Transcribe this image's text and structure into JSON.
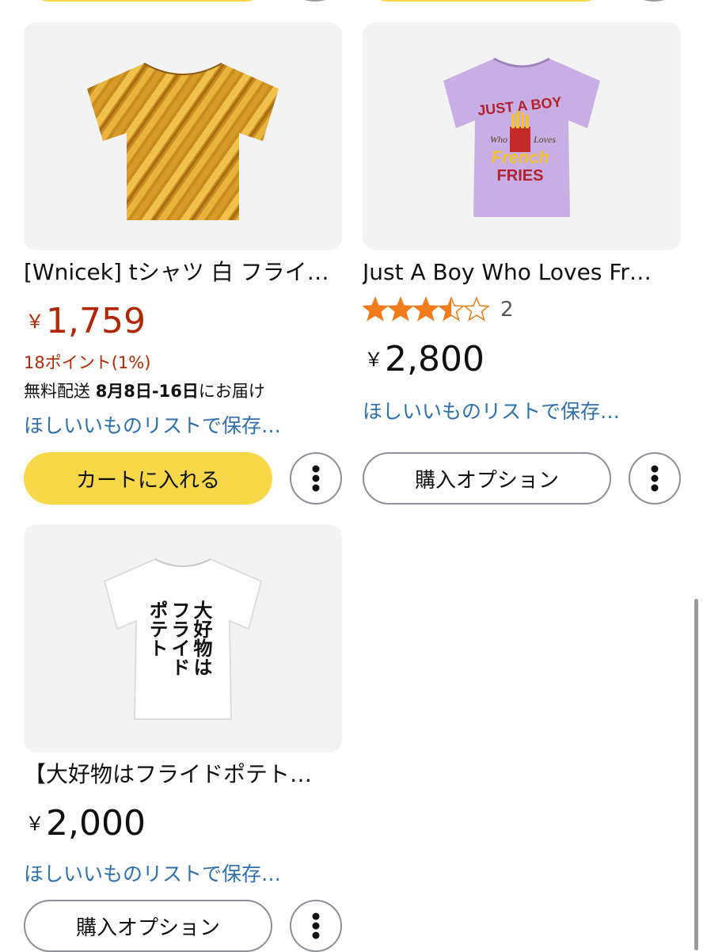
{
  "products": [
    {
      "title": "[Wnicek] tシャツ 白 フライ…",
      "price_symbol": "￥",
      "price": "1,759",
      "points": "18ポイント(1%)",
      "delivery_prefix": "無料配送 ",
      "delivery_date": "8月8日-16日",
      "delivery_suffix": "にお届け",
      "wishlist": "ほしいいものリストで保存…",
      "cart_label": "カートに入れる"
    },
    {
      "title": "Just A Boy Who Loves Fr…",
      "rating": 3.5,
      "rating_count": "2",
      "price_symbol": "￥",
      "price": "2,800",
      "wishlist": "ほしいいものリストで保存…",
      "options_label": "購入オプション",
      "shirt_text": {
        "line1": "JUST A BOY",
        "line2a": "Who",
        "line2b": "Loves",
        "line3": "French",
        "line4": "FRIES"
      }
    },
    {
      "title": "【大好物はフライドポテト…",
      "price_symbol": "￥",
      "price": "2,000",
      "wishlist": "ほしいいものリストで保存…",
      "options_label": "購入オプション",
      "shirt_text": {
        "col1": "大好物は",
        "col2": "フライド",
        "col3": "ポテト"
      }
    }
  ],
  "colors": {
    "cart_yellow": "#f8d848",
    "price_red": "#b12704",
    "link_blue": "#2e6fad",
    "star_orange": "#f07c1b"
  },
  "icons": {
    "more": "kebab-vertical-icon",
    "star": "star-icon"
  }
}
